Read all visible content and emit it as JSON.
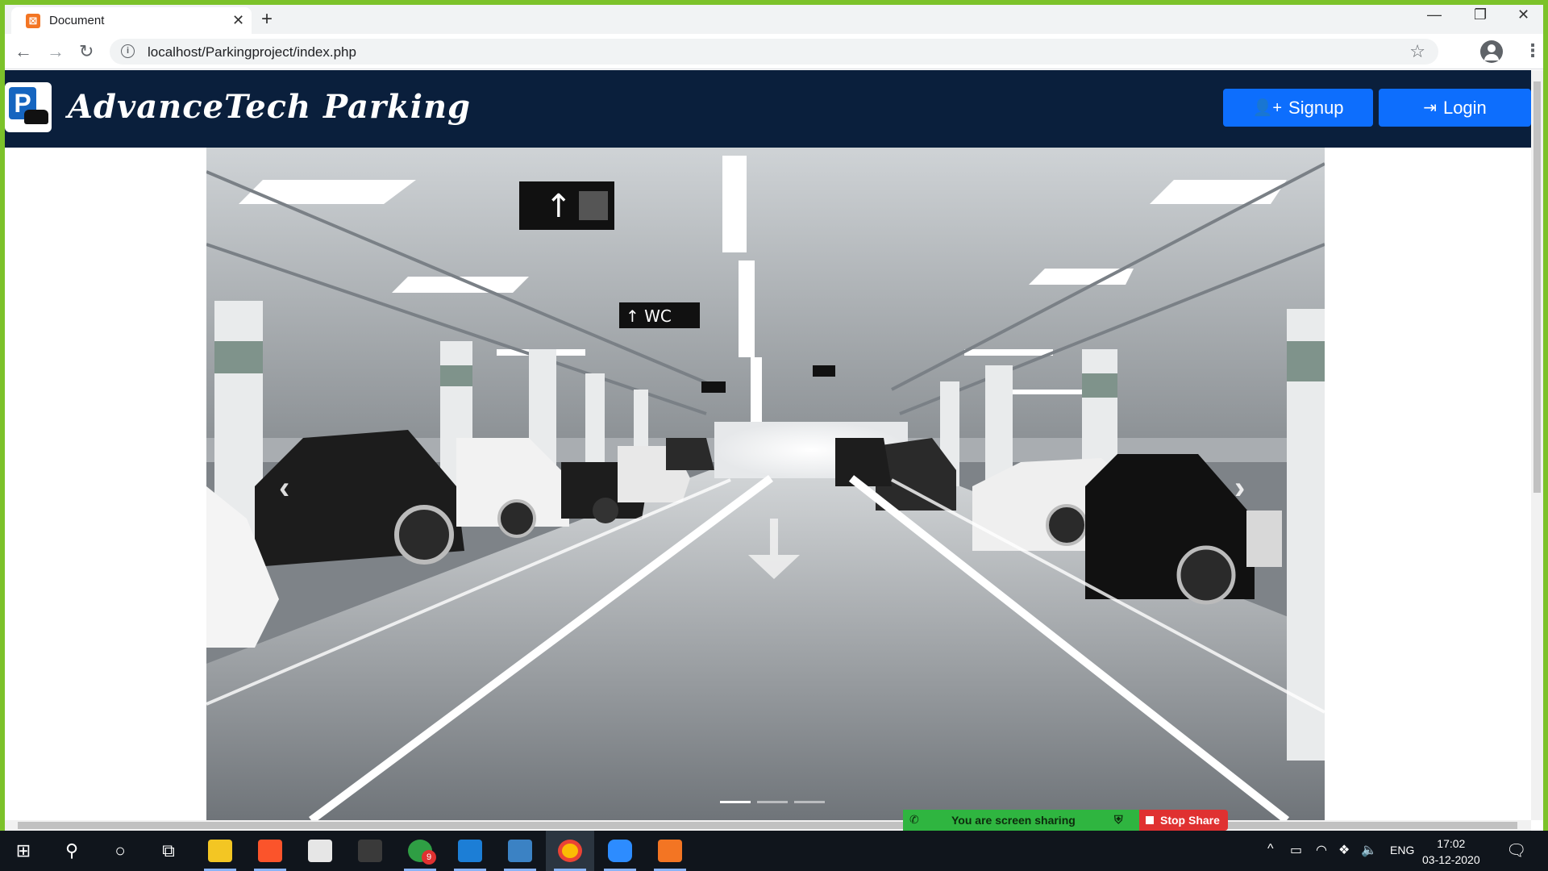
{
  "browser": {
    "tab_title": "Document",
    "tab_favicon": "xampp-icon",
    "url": "localhost/Parkingproject/index.php"
  },
  "navbar": {
    "brand_name": "AdvanceTech Parking",
    "signup_label": "Signup",
    "login_label": "Login",
    "bg_color": "#0a1f3c",
    "button_color": "#0d6efd"
  },
  "carousel": {
    "image": "parking-garage-photo",
    "indicators": 3,
    "active_indicator": 1
  },
  "screen_share": {
    "status_text": "You are screen sharing",
    "stop_label": "Stop Share"
  },
  "taskbar": {
    "tray_language": "ENG",
    "time": "17:02",
    "date": "03-12-2020",
    "badge_count": "9"
  }
}
